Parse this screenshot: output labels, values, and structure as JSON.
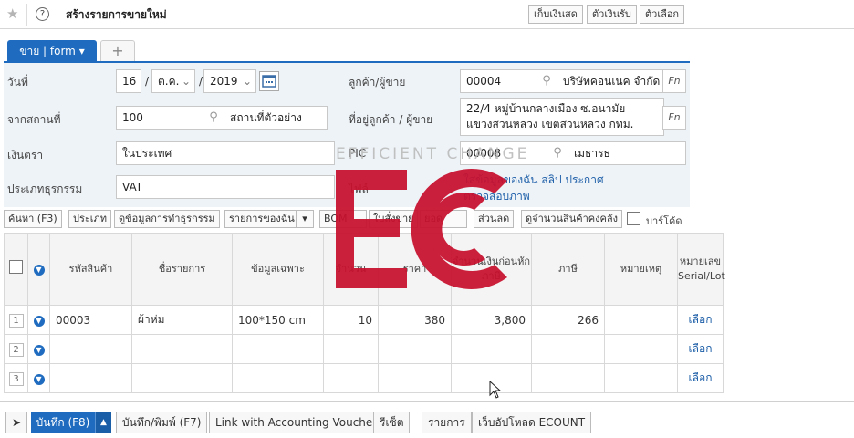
{
  "header": {
    "title": "สร้างรายการขายใหม่",
    "buttons": [
      "เก็บเงินสด",
      "ตัวเงินรับ",
      "ตัวเลือก"
    ]
  },
  "tabs": {
    "active": "ขาย | form",
    "active_caret": "▾",
    "add": "+"
  },
  "form": {
    "date_label": "วันที่",
    "day": "16",
    "month": "ต.ค.",
    "year": "2019",
    "customer_label": "ลูกค้า/ผู้ขาย",
    "customer_code": "00004",
    "customer_name": "บริษัทคอนเนค จำกัด",
    "fn_label": "Fn",
    "from_label": "จากสถานที่",
    "location_code": "100",
    "location_name": "สถานที่ตัวอย่าง",
    "address_label": "ที่อยู่ลูกค้า / ผู้ขาย",
    "address_line1": "22/4 หมู่บ้านกลางเมือง ซ.อนามัย",
    "address_line2": "แขวงสวนหลวง เขตสวนหลวง กทม.",
    "currency_label": "เงินตรา",
    "currency_value": "ในประเทศ",
    "pic_label": "PIC",
    "pic_code": "00008",
    "pic_name": "เมธารธ",
    "txn_type_label": "ประเภทธุรกรรม",
    "txn_type_value": "VAT",
    "file_label": "ไฟล์",
    "links_row1": "ใส่ข้อมูลของฉัน สลิป ประกาศ",
    "links_row2": "ตรวจสอบภาพ"
  },
  "toolbar": {
    "search": "ค้นหา (F3)",
    "category": "ประเภท",
    "view_txn": "ดูข้อมูลการทำธุรกรรม",
    "my_items": "รายการของฉัน",
    "bom": "BOM",
    "quote": "ใบสั่งขาย",
    "order": "ยอด",
    "discount": "ส่วนลด",
    "stock": "ดูจำนวนสินค้าคงคลัง",
    "barcode": "บาร์โค้ด"
  },
  "table": {
    "headers": [
      "รหัสสินค้า",
      "ชื่อรายการ",
      "ข้อมูลเฉพาะ",
      "จำนวน",
      "ราคา",
      "จำนวนเงินก่อนหักภาษี",
      "ภาษี",
      "หมายเหตุ",
      "หมายเลข Serial/Lot"
    ],
    "rows": [
      {
        "no": "1",
        "code": "00003",
        "name": "ผ้าห่ม",
        "spec": "100*150 cm",
        "qty": "10",
        "price": "380",
        "amount": "3,800",
        "vat": "266",
        "note": "",
        "serial": "เลือก"
      },
      {
        "no": "2",
        "code": "",
        "name": "",
        "spec": "",
        "qty": "",
        "price": "",
        "amount": "",
        "vat": "",
        "note": "",
        "serial": "เลือก"
      },
      {
        "no": "3",
        "code": "",
        "name": "",
        "spec": "",
        "qty": "",
        "price": "",
        "amount": "",
        "vat": "",
        "note": "",
        "serial": "เลือก"
      }
    ]
  },
  "bottom": {
    "save": "บันทึก (F8)",
    "save_print": "บันทึก/พิมพ์ (F7)",
    "link_vouchers": "Link with Accounting Vouchers",
    "receipt": "รีเซ็ต",
    "list": "รายการ",
    "upload": "เว็บอัปโหลด ECOUNT"
  },
  "watermark": {
    "text": "EFFICIENT CHANGE",
    "color": "#c8102e"
  },
  "colors": {
    "primary": "#1e6bbf",
    "link": "#1e5fa8",
    "form_bg": "#eef3f8"
  }
}
